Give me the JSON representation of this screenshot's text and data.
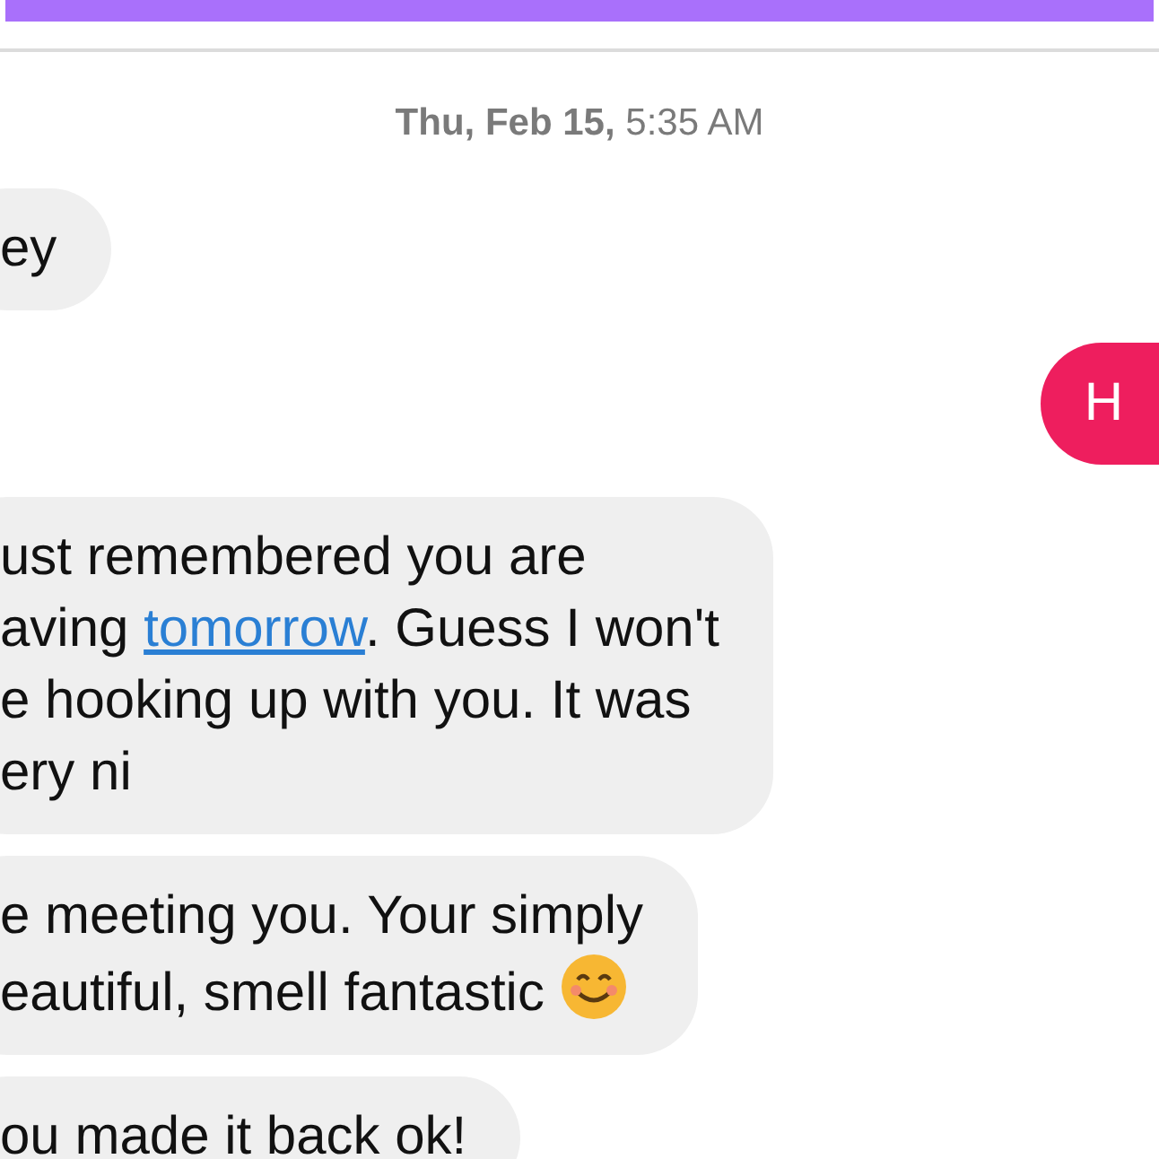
{
  "date_header": "**Thu, Feb 15,** 5:35 AM",
  "messages": [
    {
      "kind": "incoming",
      "lines": [
        [
          {
            "text": "ey"
          }
        ]
      ]
    },
    {
      "kind": "outgoing",
      "lines": [
        [
          {
            "text": "H"
          }
        ]
      ]
    },
    {
      "kind": "incoming",
      "lines": [
        [
          {
            "text": "ust remembered you are"
          }
        ],
        [
          {
            "text": "aving "
          },
          {
            "kind": "link",
            "text": "tomorrow"
          },
          {
            "text": ". Guess I won't"
          }
        ],
        [
          {
            "text": "e hooking up with you. It was"
          }
        ],
        [
          {
            "text": "ery ni"
          }
        ]
      ]
    },
    {
      "kind": "incoming",
      "lines": [
        [
          {
            "text": "e meeting you. Your simply"
          }
        ],
        [
          {
            "text": "eautiful, smell fantastic "
          },
          {
            "kind": "emoji"
          }
        ]
      ]
    },
    {
      "kind": "incoming",
      "lines": [
        [
          {
            "text": "ou made it back ok!"
          }
        ]
      ]
    }
  ]
}
